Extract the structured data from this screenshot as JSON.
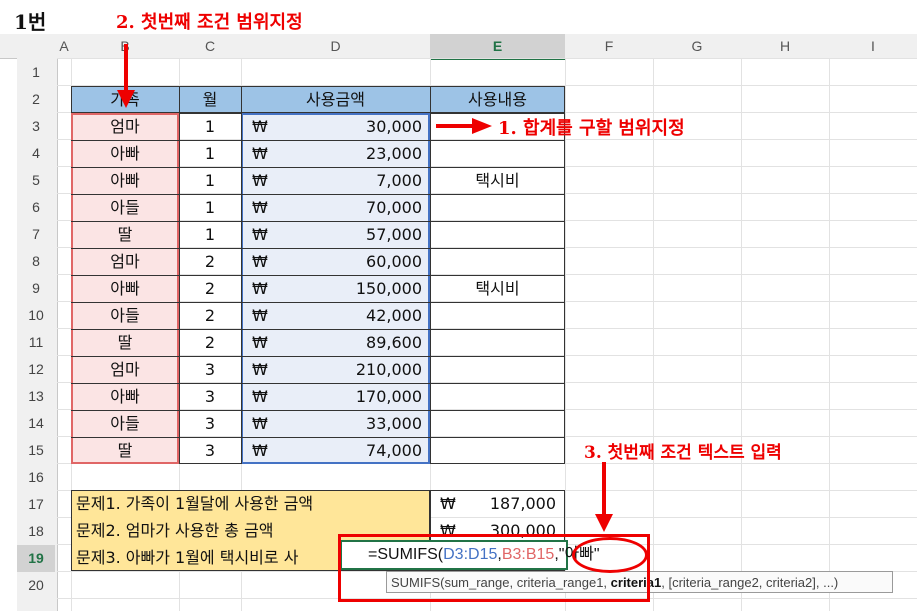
{
  "sheet_label": "1번",
  "columns": [
    "A",
    "B",
    "C",
    "D",
    "E",
    "F",
    "G",
    "H",
    "I"
  ],
  "rows": [
    "1",
    "2",
    "3",
    "4",
    "5",
    "6",
    "7",
    "8",
    "9",
    "10",
    "11",
    "12",
    "13",
    "14",
    "15",
    "16",
    "17",
    "18",
    "19",
    "20"
  ],
  "headers": {
    "family": "가족",
    "month": "월",
    "amount": "사용금액",
    "usage": "사용내용"
  },
  "currency": "₩",
  "table": [
    {
      "family": "엄마",
      "month": "1",
      "amount": "30,000",
      "usage": ""
    },
    {
      "family": "아빠",
      "month": "1",
      "amount": "23,000",
      "usage": ""
    },
    {
      "family": "아빠",
      "month": "1",
      "amount": "7,000",
      "usage": "택시비"
    },
    {
      "family": "아들",
      "month": "1",
      "amount": "70,000",
      "usage": ""
    },
    {
      "family": "딸",
      "month": "1",
      "amount": "57,000",
      "usage": ""
    },
    {
      "family": "엄마",
      "month": "2",
      "amount": "60,000",
      "usage": ""
    },
    {
      "family": "아빠",
      "month": "2",
      "amount": "150,000",
      "usage": "택시비"
    },
    {
      "family": "아들",
      "month": "2",
      "amount": "42,000",
      "usage": ""
    },
    {
      "family": "딸",
      "month": "2",
      "amount": "89,600",
      "usage": ""
    },
    {
      "family": "엄마",
      "month": "3",
      "amount": "210,000",
      "usage": ""
    },
    {
      "family": "아빠",
      "month": "3",
      "amount": "170,000",
      "usage": ""
    },
    {
      "family": "아들",
      "month": "3",
      "amount": "33,000",
      "usage": ""
    },
    {
      "family": "딸",
      "month": "3",
      "amount": "74,000",
      "usage": ""
    }
  ],
  "questions": [
    {
      "text": "문제1. 가족이 1월달에 사용한 금액",
      "result": "187,000"
    },
    {
      "text": "문제2. 엄마가 사용한 총 금액",
      "result": "300,000"
    },
    {
      "text": "문제3. 아빠가 1월에 택시비로 사",
      "result": ""
    }
  ],
  "formula": {
    "prefix": "=SUMIFS(",
    "arg1": "D3:D15",
    "sep1": ",",
    "arg2": "B3:B15",
    "sep2": ",",
    "arg3": "\"아빠\""
  },
  "tooltip": {
    "prefix": "SUMIFS(sum_range, criteria_range1, ",
    "bold": "criteria1",
    "suffix": ", [criteria_range2, criteria2], ...)"
  },
  "annotations": {
    "step1": "1. 합계를 구할 범위지정",
    "step2": "2. 첫번째 조건 범위지정",
    "step3": "3. 첫번째 조건 텍스트 입력"
  },
  "colors": {
    "header_fill": "#9dc3e6",
    "question_fill": "#ffe699",
    "accent_red": "#e00000",
    "range_blue": "#4472c4",
    "range_red": "#e06666"
  }
}
